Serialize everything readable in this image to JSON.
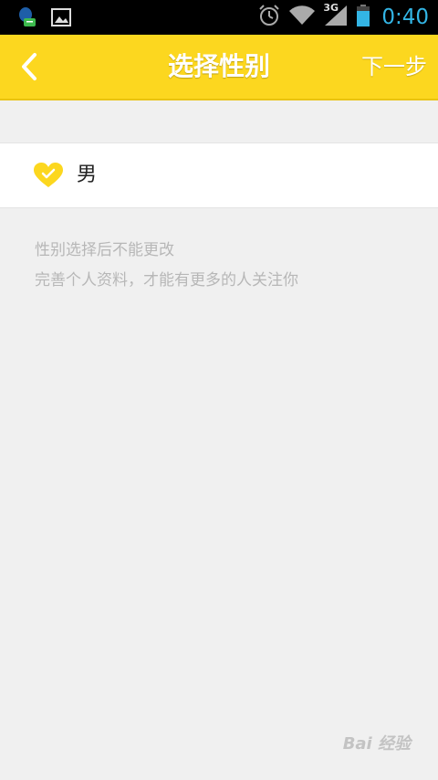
{
  "status_bar": {
    "time": "0:40",
    "network_label": "3G",
    "icons": [
      "notification-app-icon",
      "image-notification-icon",
      "alarm-icon",
      "wifi-icon",
      "signal-icon",
      "battery-icon"
    ]
  },
  "header": {
    "title": "选择性别",
    "next_label": "下一步",
    "background_color": "#fcd71f"
  },
  "gender_option": {
    "label": "男",
    "icon": "heart-icon",
    "icon_color": "#fcd71f"
  },
  "hints": {
    "line1": "性别选择后不能更改",
    "line2": "完善个人资料，才能有更多的人关注你"
  },
  "watermark": {
    "text": "Bai 经验"
  }
}
